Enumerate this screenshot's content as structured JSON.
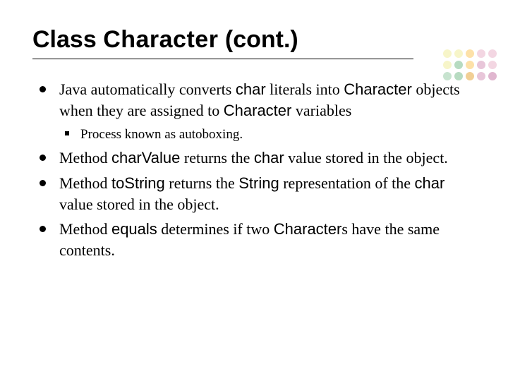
{
  "title": {
    "pre": "Class ",
    "code": "Character",
    "post": " (cont.)"
  },
  "bullets": {
    "b1": {
      "t1": "Java automatically converts ",
      "c1": "char",
      "t2": " literals into ",
      "c2": "Character",
      "t3": " objects when they are assigned to ",
      "c3": "Character",
      "t4": " variables",
      "sub1": "Process known as autoboxing."
    },
    "b2": {
      "t1": "Method ",
      "c1": "charValue",
      "t2": " returns the ",
      "c2": "char",
      "t3": " value stored in the object."
    },
    "b3": {
      "t1": "Method ",
      "c1": "toString",
      "t2": " returns the ",
      "c2": "String",
      "t3": " representation of the ",
      "c3": "char",
      "t4": " value stored in the object."
    },
    "b4": {
      "t1": "Method ",
      "c1": "equals",
      "t2": " determines if two ",
      "c2": "Character",
      "t3": "s have the same contents."
    }
  },
  "decor": {
    "colors": [
      "#f7f5c9",
      "#f7f5c9",
      "#fde1a8",
      "#f3d6e2",
      "#f3d6e2",
      "#f7f5c9",
      "#b7dbc1",
      "#fde1a8",
      "#e8c6d9",
      "#f3d6e2",
      "#c7e3cf",
      "#b7dbc1",
      "#f1cf95",
      "#e8c6d9",
      "#e0b6cf"
    ]
  }
}
